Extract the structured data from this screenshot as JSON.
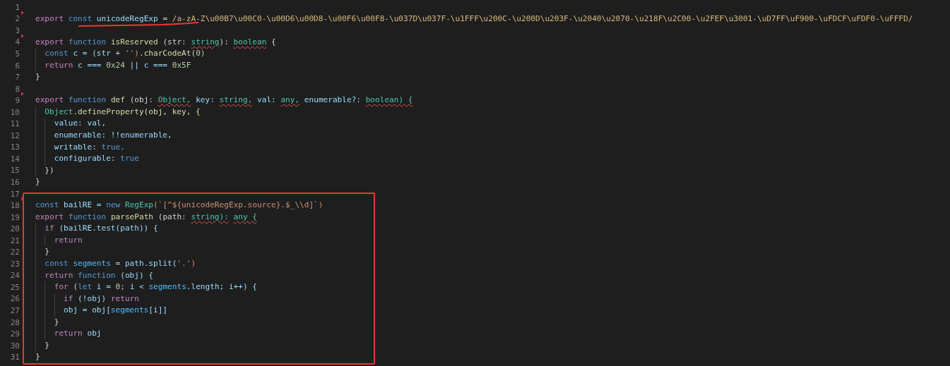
{
  "editor": {
    "lines": [
      {
        "number": "1",
        "marker": false,
        "underlined": false
      },
      {
        "number": "2",
        "marker": true,
        "underlined": true,
        "tokens": [
          {
            "kind": "kw",
            "text": "export"
          },
          {
            "kind": "st",
            "text": "const"
          },
          {
            "kind": "var",
            "text": "unicodeRegExp"
          },
          {
            "kind": "p",
            "text": "="
          },
          {
            "kind": "re",
            "text": "/a-zA-Z\\u00B7\\u00C0-\\u00D6\\u00D8-\\u00F6\\u00F8-\\u037D\\u037F-\\u1FFF\\u200C-\\u200D\\u203F-\\u2040\\u2070-\\u218F\\u2C00-\\u2FEF\\u3001-\\uD7FF\\uF900-\\uFDCF\\uFDF0-\\uFFFD/"
          }
        ]
      },
      {
        "number": "3",
        "marker": false,
        "underlined": false
      },
      {
        "number": "4",
        "marker": true,
        "underlined": false,
        "tokens": [
          {
            "kind": "kw",
            "text": "export"
          },
          {
            "kind": "st",
            "text": "function"
          },
          {
            "kind": "fn",
            "text": "isReserved"
          },
          {
            "kind": "p",
            "text": "(str:"
          },
          {
            "kind": "type",
            "text": "string"
          },
          {
            "kind": "p",
            "text": "):",
            "join": true
          },
          {
            "kind": "type",
            "text": "boolean"
          },
          {
            "kind": "p",
            "text": "{"
          }
        ],
        "children": [
          {
            "number": "5",
            "marker": false,
            "underlined": false,
            "tokens": [
              {
                "kind": "st",
                "text": "const"
              },
              {
                "kind": "var",
                "text": "c = (str +"
              },
              {
                "kind": "str",
                "text": "'')"
              },
              {
                "kind": "fn",
                "text": ".charCodeAt(",
                "join": true
              },
              {
                "kind": "num",
                "text": "0)",
                "join": true
              }
            ]
          },
          {
            "number": "6",
            "marker": false,
            "underlined": false,
            "tokens": [
              {
                "kind": "kw",
                "text": "return"
              },
              {
                "kind": "var",
                "text": "c ==="
              },
              {
                "kind": "num",
                "text": "0x24"
              },
              {
                "kind": "var",
                "text": "|| c ==="
              },
              {
                "kind": "num",
                "text": "0x5F"
              }
            ]
          }
        ]
      },
      {
        "number": "7",
        "marker": false,
        "underlined": false,
        "tokens": [
          {
            "kind": "p",
            "text": "}"
          }
        ]
      },
      {
        "number": "8",
        "marker": false,
        "underlined": false
      },
      {
        "number": "9",
        "marker": true,
        "underlined": false,
        "tokens": [
          {
            "kind": "kw",
            "text": "export"
          },
          {
            "kind": "st",
            "text": "function"
          },
          {
            "kind": "fn",
            "text": "def"
          },
          {
            "kind": "p",
            "text": "(obj:"
          },
          {
            "kind": "type",
            "text": "Object,"
          },
          {
            "kind": "var",
            "text": "key:"
          },
          {
            "kind": "type",
            "text": "string,"
          },
          {
            "kind": "var",
            "text": "val:"
          },
          {
            "kind": "type",
            "text": "any,"
          },
          {
            "kind": "var",
            "text": "enumerable?:"
          },
          {
            "kind": "type",
            "text": "boolean) {"
          }
        ],
        "children": [
          {
            "number": "10",
            "marker": false,
            "underlined": false,
            "tokens": [
              {
                "kind": "cls",
                "text": "Object"
              },
              {
                "kind": "fn",
                "text": ".defineProperty(obj, key, {",
                "join": true
              }
            ],
            "children": [
              {
                "number": "11",
                "marker": false,
                "underlined": false,
                "tokens": [
                  {
                    "kind": "var",
                    "text": "value: val,"
                  }
                ]
              },
              {
                "number": "12",
                "marker": false,
                "underlined": false,
                "tokens": [
                  {
                    "kind": "var",
                    "text": "enumerable: !!enumerable,"
                  }
                ]
              },
              {
                "number": "13",
                "marker": false,
                "underlined": false,
                "tokens": [
                  {
                    "kind": "var",
                    "text": "writable:"
                  },
                  {
                    "kind": "st",
                    "text": "true,"
                  }
                ]
              },
              {
                "number": "14",
                "marker": false,
                "underlined": false,
                "tokens": [
                  {
                    "kind": "var",
                    "text": "configurable:"
                  },
                  {
                    "kind": "st",
                    "text": "true"
                  }
                ]
              }
            ]
          },
          {
            "number": "15",
            "marker": false,
            "underlined": false,
            "tokens": [
              {
                "kind": "p",
                "text": "})"
              }
            ]
          }
        ]
      },
      {
        "number": "16",
        "marker": false,
        "underlined": false,
        "tokens": [
          {
            "kind": "p",
            "text": "}"
          }
        ]
      },
      {
        "number": "17",
        "marker": false,
        "underlined": false
      }
    ],
    "highlighted_block": {
      "lines": [
        {
          "number": "18",
          "marker": true,
          "underlined": false,
          "tokens": [
            {
              "kind": "st",
              "text": "const"
            },
            {
              "kind": "var",
              "text": "bailRE ="
            },
            {
              "kind": "st",
              "text": "new"
            },
            {
              "kind": "cls",
              "text": "RegExp"
            },
            {
              "kind": "str",
              "text": "(`[^${unicodeRegExp.source}.$_\\\\d]`)",
              "join": true
            }
          ]
        },
        {
          "number": "19",
          "marker": false,
          "underlined": false,
          "tokens": [
            {
              "kind": "kw",
              "text": "export"
            },
            {
              "kind": "st",
              "text": "function"
            },
            {
              "kind": "fn",
              "text": "parsePath"
            },
            {
              "kind": "p",
              "text": "(path:"
            },
            {
              "kind": "type",
              "text": "string):"
            },
            {
              "kind": "type",
              "text": "any {"
            }
          ],
          "children": [
            {
              "number": "20",
              "marker": false,
              "underlined": false,
              "tokens": [
                {
                  "kind": "kw",
                  "text": "if"
                },
                {
                  "kind": "var",
                  "text": "(bailRE.test(path)) {"
                }
              ],
              "children": [
                {
                  "number": "21",
                  "marker": false,
                  "underlined": false,
                  "tokens": [
                    {
                      "kind": "kw",
                      "text": "return"
                    }
                  ]
                }
              ]
            },
            {
              "number": "22",
              "marker": false,
              "underlined": false,
              "tokens": [
                {
                  "kind": "p",
                  "text": "}"
                }
              ]
            },
            {
              "number": "23",
              "marker": false,
              "underlined": false,
              "tokens": [
                {
                  "kind": "st",
                  "text": "const"
                },
                {
                  "kind": "cst",
                  "text": "segments"
                },
                {
                  "kind": "var",
                  "text": "= path.split("
                },
                {
                  "kind": "str",
                  "text": "'.')",
                  "join": true
                }
              ]
            },
            {
              "number": "24",
              "marker": false,
              "underlined": false,
              "tokens": [
                {
                  "kind": "kw",
                  "text": "return"
                },
                {
                  "kind": "st",
                  "text": "function"
                },
                {
                  "kind": "var",
                  "text": "(obj) {"
                }
              ],
              "children": [
                {
                  "number": "25",
                  "marker": false,
                  "underlined": false,
                  "tokens": [
                    {
                      "kind": "kw",
                      "text": "for"
                    },
                    {
                      "kind": "p",
                      "text": "("
                    },
                    {
                      "kind": "st",
                      "text": "let",
                      "join": true
                    },
                    {
                      "kind": "var",
                      "text": "i ="
                    },
                    {
                      "kind": "num",
                      "text": "0;"
                    },
                    {
                      "kind": "var",
                      "text": "i <"
                    },
                    {
                      "kind": "cst",
                      "text": "segments"
                    },
                    {
                      "kind": "var",
                      "text": ".length; i++) {",
                      "join": true
                    }
                  ],
                  "children": [
                    {
                      "number": "26",
                      "marker": false,
                      "underlined": false,
                      "tokens": [
                        {
                          "kind": "kw",
                          "text": "if"
                        },
                        {
                          "kind": "var",
                          "text": "(!obj)"
                        },
                        {
                          "kind": "kw",
                          "text": "return"
                        }
                      ]
                    },
                    {
                      "number": "27",
                      "marker": false,
                      "underlined": false,
                      "tokens": [
                        {
                          "kind": "var",
                          "text": "obj = obj["
                        },
                        {
                          "kind": "cst",
                          "text": "segments",
                          "join": true
                        },
                        {
                          "kind": "var",
                          "text": "[i]]",
                          "join": true
                        }
                      ]
                    }
                  ]
                },
                {
                  "number": "28",
                  "marker": false,
                  "underlined": false,
                  "tokens": [
                    {
                      "kind": "p",
                      "text": "}"
                    }
                  ]
                },
                {
                  "number": "29",
                  "marker": false,
                  "underlined": false,
                  "tokens": [
                    {
                      "kind": "kw",
                      "text": "return"
                    },
                    {
                      "kind": "var",
                      "text": "obj"
                    }
                  ]
                }
              ]
            },
            {
              "number": "30",
              "marker": false,
              "underlined": false,
              "tokens": [
                {
                  "kind": "p",
                  "text": "}"
                }
              ]
            }
          ]
        },
        {
          "number": "31",
          "marker": false,
          "underlined": false,
          "tokens": [
            {
              "kind": "p",
              "text": "}"
            }
          ]
        }
      ]
    }
  }
}
